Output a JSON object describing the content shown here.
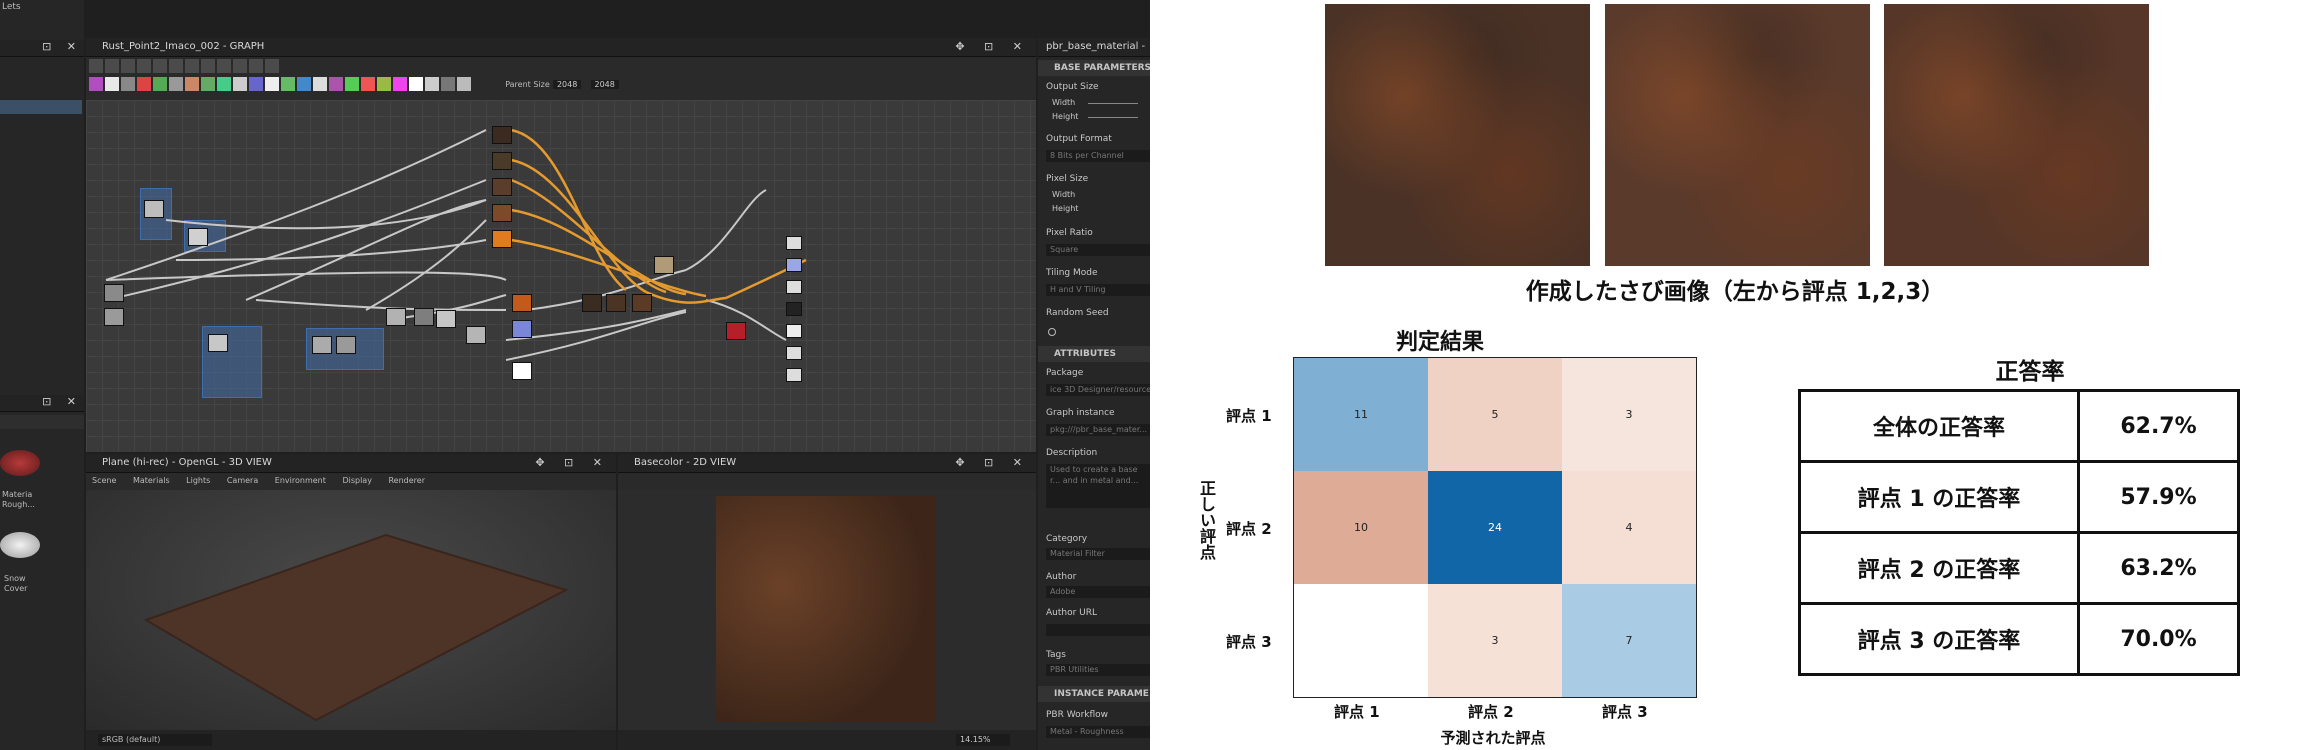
{
  "app": {
    "left_strip": {
      "title": "Lets",
      "items": [
        {
          "label": "Materia\nRough..."
        },
        {
          "label": "Snow\nCover"
        }
      ]
    },
    "graph_panel": {
      "title": "Rust_Point2_Imaco_002 - GRAPH",
      "parent_size_label": "Parent Size",
      "parent_size_value": "2048",
      "second_size_value": "2048"
    },
    "view3d": {
      "title": "Plane (hi-rec) - OpenGL - 3D VIEW",
      "menu": [
        "Scene",
        "Materials",
        "Lights",
        "Camera",
        "Environment",
        "Display",
        "Renderer"
      ],
      "colorspace": "sRGB (default)"
    },
    "view2d": {
      "title": "Basecolor - 2D VIEW",
      "zoom": "14.15%"
    },
    "properties": {
      "title": "pbr_base_material -",
      "sections": {
        "base": "BASE PARAMETERS",
        "attributes": "ATTRIBUTES",
        "instance": "INSTANCE PARAME"
      },
      "fields": {
        "output_size": "Output Size",
        "width": "Width",
        "height": "Height",
        "output_format": "Output Format",
        "output_format_value": "8 Bits per Channel",
        "pixel_size": "Pixel Size",
        "pixel_size_width": "Width",
        "pixel_size_height": "Height",
        "pixel_ratio": "Pixel Ratio",
        "pixel_ratio_value": "Square",
        "tiling_mode": "Tiling Mode",
        "tiling_mode_value": "H and V Tiling",
        "random_seed": "Random Seed",
        "package": "Package",
        "package_value": "ice 3D Designer/resources",
        "graph_instance": "Graph instance",
        "graph_instance_value": "pkg:///pbr_base_mater...",
        "description": "Description",
        "description_value": "Used to create a base r... and in metal and...",
        "category": "Category",
        "category_value": "Material Filter",
        "author": "Author",
        "author_value": "Adobe",
        "author_url": "Author URL",
        "tags": "Tags",
        "tags_value": "PBR Utilities",
        "pbr_workflow": "PBR Workflow",
        "pbr_workflow_value": "Metal - Roughness"
      }
    }
  },
  "rust": {
    "caption": "作成したさび画像（左から評点 1,2,3）",
    "colors": [
      "#4a3226",
      "#5a3a2b",
      "#553628"
    ]
  },
  "confusion": {
    "title": "判定結果",
    "ylabel": "正しい評点",
    "xlabel": "予測された評点",
    "rows": [
      "評点 1",
      "評点 2",
      "評点 3"
    ],
    "cols": [
      "評点 1",
      "評点 2",
      "評点 3"
    ],
    "values": [
      [
        11,
        5,
        3
      ],
      [
        10,
        24,
        4
      ],
      [
        null,
        3,
        7
      ]
    ],
    "colors": [
      [
        "#7fb0d3",
        "#f0d2c4",
        "#f6e5dc"
      ],
      [
        "#deab96",
        "#1166a8",
        "#f5dfd4"
      ],
      [
        "#ffffff",
        "#f6e1d7",
        "#a9cbe3"
      ]
    ]
  },
  "accuracy": {
    "title": "正答率",
    "rows": [
      {
        "label": "全体の正答率",
        "value": "62.7%"
      },
      {
        "label": "評点 1 の正答率",
        "value": "57.9%"
      },
      {
        "label": "評点 2 の正答率",
        "value": "63.2%"
      },
      {
        "label": "評点 3 の正答率",
        "value": "70.0%"
      }
    ]
  }
}
